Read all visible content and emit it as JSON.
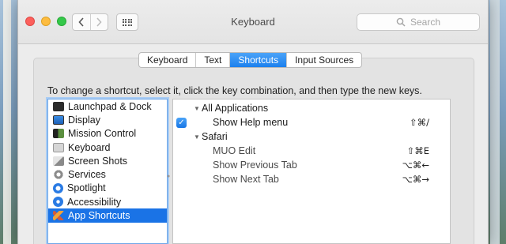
{
  "window": {
    "title": "Keyboard"
  },
  "toolbar": {
    "back_icon": "chevron-left-icon",
    "forward_icon": "chevron-right-icon",
    "show_all_icon": "grid-icon"
  },
  "search": {
    "placeholder": "Search"
  },
  "tabs": [
    {
      "label": "Keyboard",
      "active": false
    },
    {
      "label": "Text",
      "active": false
    },
    {
      "label": "Shortcuts",
      "active": true
    },
    {
      "label": "Input Sources",
      "active": false
    }
  ],
  "instruction": "To change a shortcut, select it, click the key combination, and then type the new keys.",
  "categories": [
    {
      "label": "Launchpad & Dock",
      "icon": "launchpad-dock-icon",
      "selected": false
    },
    {
      "label": "Display",
      "icon": "display-icon",
      "selected": false
    },
    {
      "label": "Mission Control",
      "icon": "mission-control-icon",
      "selected": false
    },
    {
      "label": "Keyboard",
      "icon": "keyboard-icon",
      "selected": false
    },
    {
      "label": "Screen Shots",
      "icon": "screen-shots-icon",
      "selected": false
    },
    {
      "label": "Services",
      "icon": "gear-icon",
      "selected": false
    },
    {
      "label": "Spotlight",
      "icon": "spotlight-icon",
      "selected": false
    },
    {
      "label": "Accessibility",
      "icon": "accessibility-icon",
      "selected": false
    },
    {
      "label": "App Shortcuts",
      "icon": "app-shortcuts-icon",
      "selected": true
    }
  ],
  "shortcuts": {
    "groups": [
      {
        "label": "All Applications",
        "items": [
          {
            "label": "Show Help menu",
            "keys": "⇧⌘/",
            "checked": true
          }
        ]
      },
      {
        "label": "Safari",
        "items": [
          {
            "label": "MUO Edit",
            "keys": "⇧⌘E"
          },
          {
            "label": "Show Previous Tab",
            "keys": "⌥⌘←"
          },
          {
            "label": "Show Next Tab",
            "keys": "⌥⌘→"
          }
        ]
      }
    ]
  },
  "colors": {
    "accent": "#1a73e6",
    "close": "#fc605c",
    "minimize": "#fdbc40",
    "zoom": "#34c84a"
  }
}
